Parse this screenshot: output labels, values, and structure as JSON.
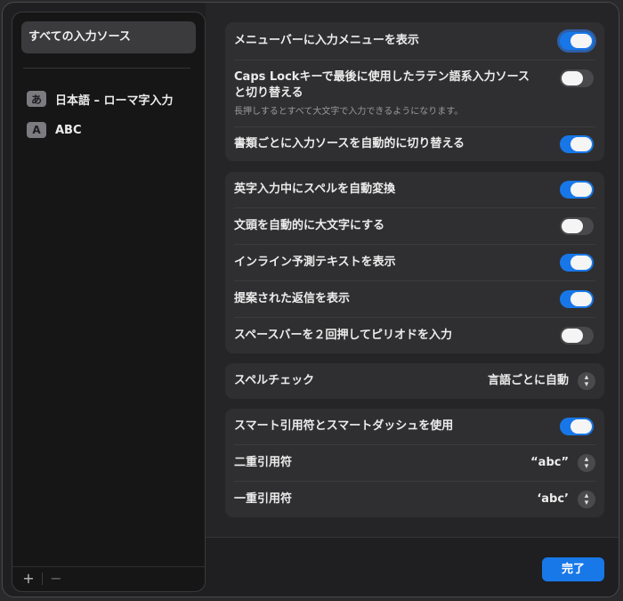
{
  "sidebar": {
    "all_sources_label": "すべての入力ソース",
    "sources": [
      {
        "badge": "あ",
        "label": "日本語 – ローマ字入力"
      },
      {
        "badge": "A",
        "label": "ABC"
      }
    ],
    "add_label": "+",
    "remove_label": "−"
  },
  "group1": {
    "show_input_menu": {
      "label": "メニューバーに入力メニューを表示",
      "state": "on"
    },
    "caps_lock": {
      "label_line1": "Caps Lockキーで最後に使用したラテン語系入力ソース",
      "label_line2": "と切り替える",
      "sub": "長押しするとすべて大文字で入力できるようになります。",
      "state": "off"
    },
    "auto_switch": {
      "label": "書類ごとに入力ソースを自動的に切り替える",
      "state": "on"
    }
  },
  "group2": {
    "items": [
      {
        "label": "英字入力中にスペルを自動変換",
        "state": "on"
      },
      {
        "label": "文頭を自動的に大文字にする",
        "state": "off"
      },
      {
        "label": "インライン予測テキストを表示",
        "state": "on"
      },
      {
        "label": "提案された返信を表示",
        "state": "on"
      },
      {
        "label": "スペースバーを２回押してピリオドを入力",
        "state": "off"
      }
    ]
  },
  "group3": {
    "spellcheck": {
      "label": "スペルチェック",
      "value": "言語ごとに自動"
    }
  },
  "group4": {
    "smart_quotes": {
      "label": "スマート引用符とスマートダッシュを使用",
      "state": "on"
    },
    "double_quote": {
      "label": "二重引用符",
      "value": "“abc”"
    },
    "single_quote": {
      "label": "一重引用符",
      "value": "‘abc’"
    }
  },
  "footer": {
    "done_label": "完了"
  },
  "colors": {
    "accent": "#1877e8",
    "toggle_off": "#49494c"
  }
}
